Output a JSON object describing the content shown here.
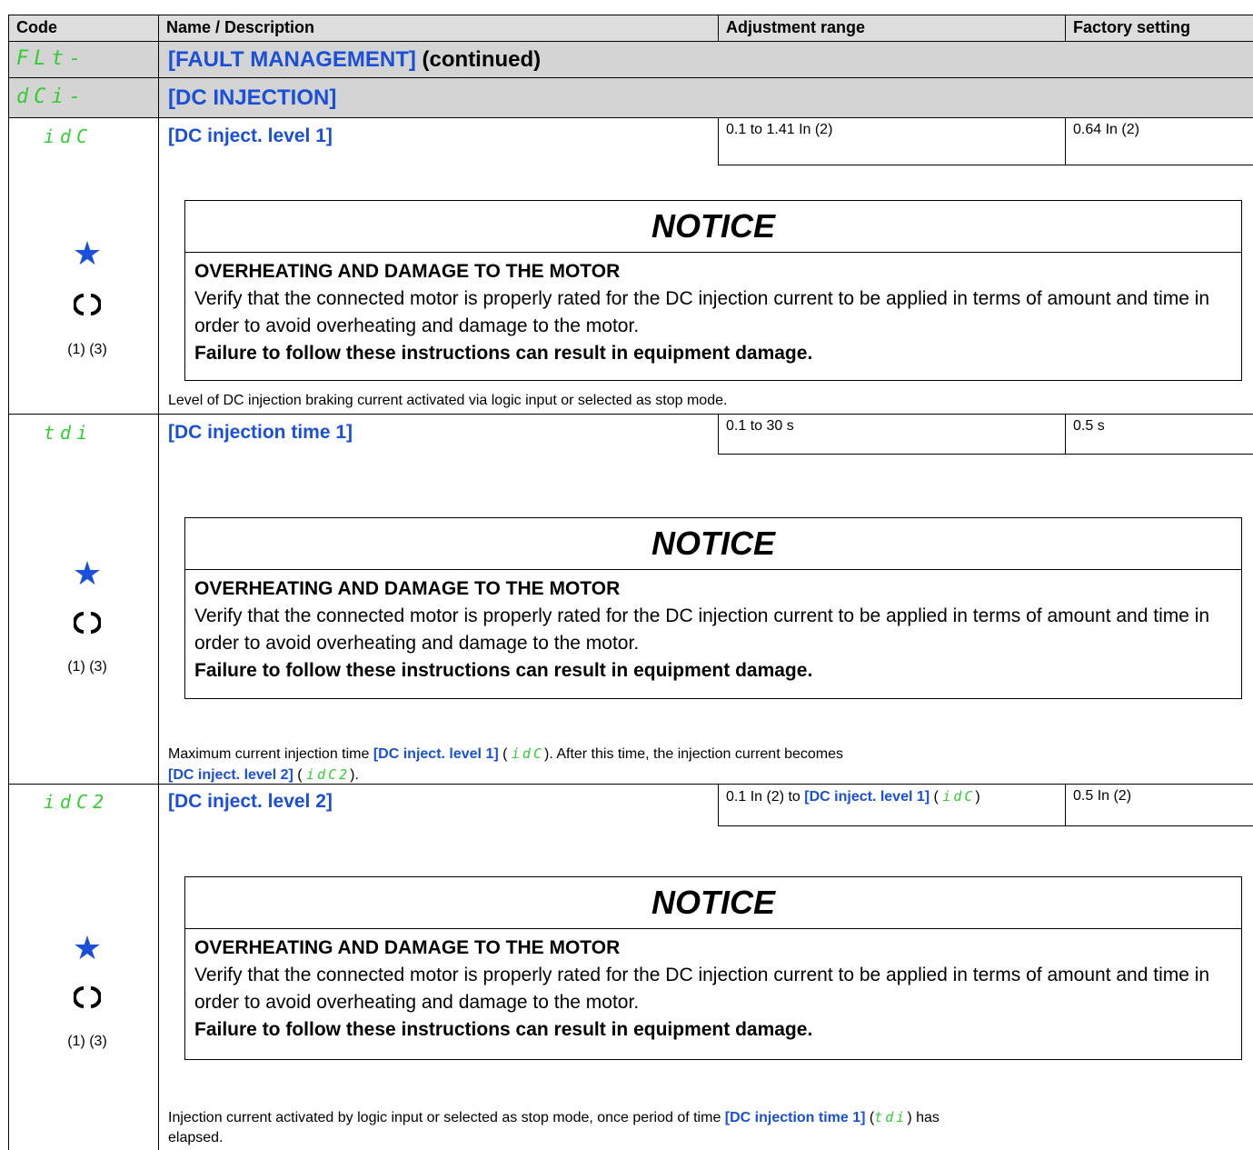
{
  "header": {
    "code": "Code",
    "name": "Name / Description",
    "range": "Adjustment range",
    "factory": "Factory setting"
  },
  "sections": [
    {
      "code": "FLt-",
      "title": "[FAULT MANAGEMENT]",
      "suffix": " (continued)"
    },
    {
      "code": "dCi-",
      "title": "[DC INJECTION]",
      "suffix": ""
    }
  ],
  "notice": {
    "title": "NOTICE",
    "heading": "OVERHEATING AND DAMAGE TO THE MOTOR",
    "text": "Verify that the connected motor is properly rated for the DC injection current to be applied in terms of amount and time in order to avoid overheating and damage to the motor.",
    "warning": "Failure to follow these instructions can result in equipment damage."
  },
  "side": {
    "star": "★",
    "footnotes": "(1) (3)"
  },
  "params": [
    {
      "code": "idC",
      "name": "[DC inject. level 1]",
      "range": "0.1 to 1.41 In (2)",
      "factory": "0.64 In (2)",
      "desc": "Level of DC injection braking current activated via logic input or selected as stop mode."
    },
    {
      "code": "tdi",
      "name": "[DC injection time 1]",
      "range": "0.1 to 30 s",
      "factory": "0.5 s",
      "desc_part1": "Maximum current injection time ",
      "desc_ref1": "[DC inject. level 1]",
      "desc_code1": "idC",
      "desc_part2": ". After this time, the injection current becomes",
      "desc_ref2": "[DC inject. level 2]",
      "desc_code2": "idC2",
      "desc_part3": "."
    },
    {
      "code": "idC2",
      "name": "[DC inject. level 2]",
      "range_prefix": "0.1 In (2) to ",
      "range_ref": "[DC inject. level 1]",
      "range_code": "idC",
      "factory": "0.5 In (2)",
      "desc_part1": "Injection current activated by logic input or selected as stop mode, once period of time ",
      "desc_ref1": "[DC injection time 1]",
      "desc_code1": "tdi",
      "desc_part2": " has",
      "desc_line2": "elapsed."
    }
  ]
}
